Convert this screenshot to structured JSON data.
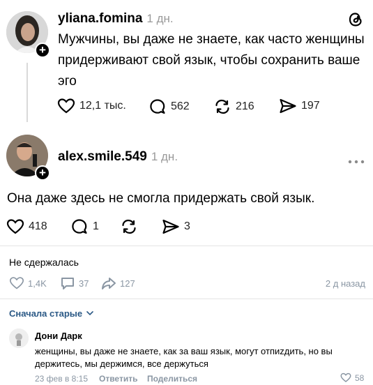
{
  "post1": {
    "username": "yliana.fomina",
    "time": "1 дн.",
    "text": "Мужчины, вы даже не знаете, как часто женщины придерживают свой язык, чтобы сохранить ваше эго",
    "likes": "12,1 тыс.",
    "comments": "562",
    "reposts": "216",
    "shares": "197"
  },
  "post2": {
    "username": "alex.smile.549",
    "time": "1 дн.",
    "text": "Она даже здесь не смогла придержать свой язык.",
    "likes": "418",
    "comments": "1",
    "shares": "3"
  },
  "vk_post": {
    "caption": "Не сдержалась",
    "likes": "1,4K",
    "comments": "37",
    "shares": "127",
    "time": "2 д назад"
  },
  "sort": {
    "label": "Сначала старые"
  },
  "comment": {
    "author": "Дони Дарк",
    "text": "женщины, вы даже не знаете, как за ваш язык, могут отпиzдить, но вы держитесь, мы держимся, все держуться",
    "date": "23 фев в 8:15",
    "reply": "Ответить",
    "share": "Поделиться",
    "likes": "58"
  }
}
